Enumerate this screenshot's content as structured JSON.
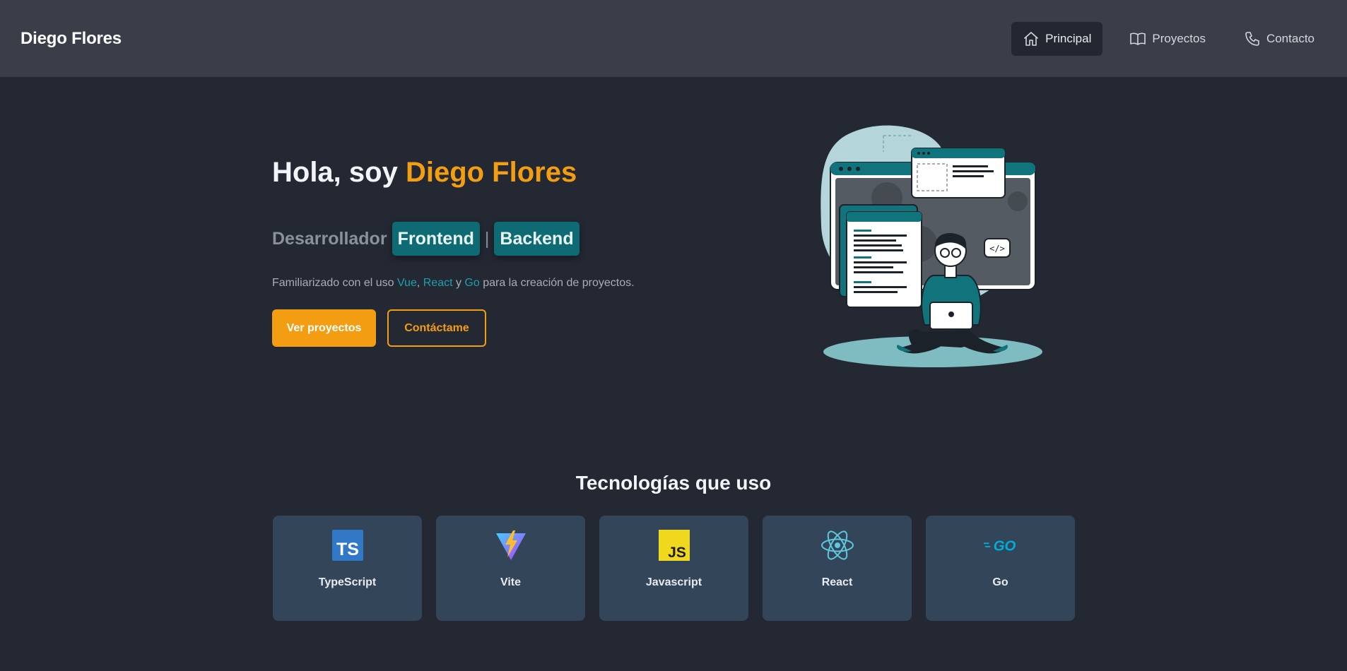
{
  "header": {
    "brand": "Diego Flores",
    "nav": [
      {
        "label": "Principal",
        "icon": "home-icon",
        "active": true
      },
      {
        "label": "Proyectos",
        "icon": "book-icon",
        "active": false
      },
      {
        "label": "Contacto",
        "icon": "phone-icon",
        "active": false
      }
    ]
  },
  "hero": {
    "greeting": "Hola, soy ",
    "name": "Diego Flores",
    "role_prefix": "Desarrollador",
    "role_frontend": "Frontend",
    "role_separator": "|",
    "role_backend": "Backend",
    "description": {
      "before": "Familiarizado con el uso ",
      "tech1": "Vue",
      "comma1": ", ",
      "tech2": "React",
      "and": " y ",
      "tech3": "Go",
      "after": " para la creación de proyectos."
    },
    "primary_button": "Ver proyectos",
    "secondary_button": "Contáctame"
  },
  "technologies": {
    "title": "Tecnologías que uso",
    "items": [
      {
        "name": "TypeScript",
        "icon": "typescript-icon"
      },
      {
        "name": "Vite",
        "icon": "vite-icon"
      },
      {
        "name": "Javascript",
        "icon": "javascript-icon"
      },
      {
        "name": "React",
        "icon": "react-icon"
      },
      {
        "name": "Go",
        "icon": "go-icon"
      }
    ]
  },
  "colors": {
    "background": "#232833",
    "header": "#3a3e49",
    "accent": "#f29d12",
    "teal": "#0e6b73",
    "card": "#324559"
  }
}
